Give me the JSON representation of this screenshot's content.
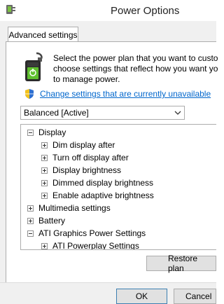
{
  "window": {
    "title": "Power Options"
  },
  "tabs": [
    {
      "label": "Advanced settings"
    }
  ],
  "description": {
    "line1": "Select the power plan that you want to custo",
    "line2": "choose settings that reflect how you want yo",
    "line3": "to manage power."
  },
  "change_link": "Change settings that are currently unavailable",
  "plan_select": {
    "value": "Balanced [Active]"
  },
  "tree": [
    {
      "label": "Display",
      "expanded": true,
      "level": 0
    },
    {
      "label": "Dim display after",
      "expanded": false,
      "level": 1
    },
    {
      "label": "Turn off display after",
      "expanded": false,
      "level": 1
    },
    {
      "label": "Display brightness",
      "expanded": false,
      "level": 1
    },
    {
      "label": "Dimmed display brightness",
      "expanded": false,
      "level": 1
    },
    {
      "label": "Enable adaptive brightness",
      "expanded": false,
      "level": 1
    },
    {
      "label": "Multimedia settings",
      "expanded": false,
      "level": 0
    },
    {
      "label": "Battery",
      "expanded": false,
      "level": 0
    },
    {
      "label": "ATI Graphics Power Settings",
      "expanded": true,
      "level": 0
    },
    {
      "label": "ATI Powerplay Settings",
      "expanded": false,
      "level": 1
    }
  ],
  "buttons": {
    "restore": "Restore plan",
    "ok": "OK",
    "cancel": "Cancel"
  },
  "colors": {
    "link": "#0066cc",
    "battery_green": "#5fbf2f"
  },
  "icons": [
    "power-options-app-icon",
    "battery-plug-icon",
    "uac-shield-icon",
    "chevron-down-icon",
    "expand-box-icon",
    "collapse-box-icon"
  ]
}
